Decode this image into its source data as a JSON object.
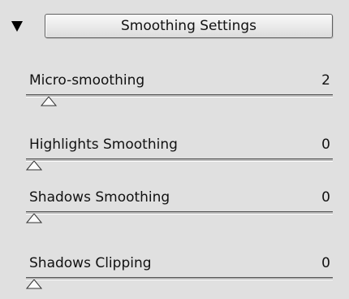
{
  "panel": {
    "section_title": "Smoothing Settings",
    "expanded": true,
    "colors": {
      "background": "#e0e0e0",
      "text": "#111111"
    }
  },
  "controls": [
    {
      "label": "Micro-smoothing",
      "value": "2",
      "slider_level": 0.05
    },
    {
      "label": "Highlights Smoothing",
      "value": "0",
      "slider_level": 0
    },
    {
      "label": "Shadows Smoothing",
      "value": "0",
      "slider_level": 0
    },
    {
      "label": "Shadows Clipping",
      "value": "0",
      "slider_level": 0
    }
  ],
  "icons": {
    "collapse": "triangle-down-icon",
    "slider_thumb": "triangle-up-icon"
  }
}
